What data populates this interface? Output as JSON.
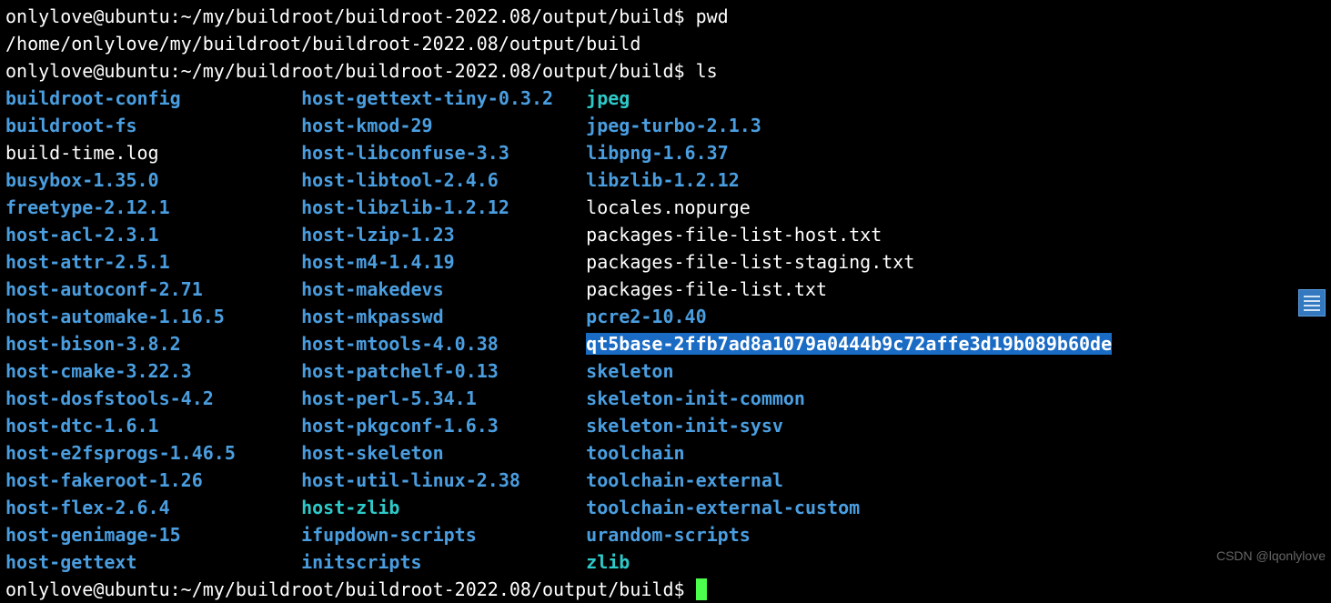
{
  "prompt1": "onlylove@ubuntu:~/my/buildroot/buildroot-2022.08/output/build$ ",
  "cmd1": "pwd",
  "pwd_out": "/home/onlylove/my/buildroot/buildroot-2022.08/output/build",
  "cmd2": "ls",
  "rows": [
    {
      "c1": {
        "t": "buildroot-config",
        "k": "dir"
      },
      "c2": {
        "t": "host-gettext-tiny-0.3.2",
        "k": "dir"
      },
      "c3": {
        "t": "jpeg",
        "k": "ln"
      }
    },
    {
      "c1": {
        "t": "buildroot-fs",
        "k": "dir"
      },
      "c2": {
        "t": "host-kmod-29",
        "k": "dir"
      },
      "c3": {
        "t": "jpeg-turbo-2.1.3",
        "k": "dir"
      }
    },
    {
      "c1": {
        "t": "build-time.log",
        "k": "file"
      },
      "c2": {
        "t": "host-libconfuse-3.3",
        "k": "dir"
      },
      "c3": {
        "t": "libpng-1.6.37",
        "k": "dir"
      }
    },
    {
      "c1": {
        "t": "busybox-1.35.0",
        "k": "dir"
      },
      "c2": {
        "t": "host-libtool-2.4.6",
        "k": "dir"
      },
      "c3": {
        "t": "libzlib-1.2.12",
        "k": "dir"
      }
    },
    {
      "c1": {
        "t": "freetype-2.12.1",
        "k": "dir"
      },
      "c2": {
        "t": "host-libzlib-1.2.12",
        "k": "dir"
      },
      "c3": {
        "t": "locales.nopurge",
        "k": "file"
      }
    },
    {
      "c1": {
        "t": "host-acl-2.3.1",
        "k": "dir"
      },
      "c2": {
        "t": "host-lzip-1.23",
        "k": "dir"
      },
      "c3": {
        "t": "packages-file-list-host.txt",
        "k": "file"
      }
    },
    {
      "c1": {
        "t": "host-attr-2.5.1",
        "k": "dir"
      },
      "c2": {
        "t": "host-m4-1.4.19",
        "k": "dir"
      },
      "c3": {
        "t": "packages-file-list-staging.txt",
        "k": "file"
      }
    },
    {
      "c1": {
        "t": "host-autoconf-2.71",
        "k": "dir"
      },
      "c2": {
        "t": "host-makedevs",
        "k": "dir"
      },
      "c3": {
        "t": "packages-file-list.txt",
        "k": "file"
      }
    },
    {
      "c1": {
        "t": "host-automake-1.16.5",
        "k": "dir"
      },
      "c2": {
        "t": "host-mkpasswd",
        "k": "dir"
      },
      "c3": {
        "t": "pcre2-10.40",
        "k": "dir"
      }
    },
    {
      "c1": {
        "t": "host-bison-3.8.2",
        "k": "dir"
      },
      "c2": {
        "t": "host-mtools-4.0.38",
        "k": "dir"
      },
      "c3": {
        "t": "qt5base-2ffb7ad8a1079a0444b9c72affe3d19b089b60de",
        "k": "sel"
      }
    },
    {
      "c1": {
        "t": "host-cmake-3.22.3",
        "k": "dir"
      },
      "c2": {
        "t": "host-patchelf-0.13",
        "k": "dir"
      },
      "c3": {
        "t": "skeleton",
        "k": "dir"
      }
    },
    {
      "c1": {
        "t": "host-dosfstools-4.2",
        "k": "dir"
      },
      "c2": {
        "t": "host-perl-5.34.1",
        "k": "dir"
      },
      "c3": {
        "t": "skeleton-init-common",
        "k": "dir"
      }
    },
    {
      "c1": {
        "t": "host-dtc-1.6.1",
        "k": "dir"
      },
      "c2": {
        "t": "host-pkgconf-1.6.3",
        "k": "dir"
      },
      "c3": {
        "t": "skeleton-init-sysv",
        "k": "dir"
      }
    },
    {
      "c1": {
        "t": "host-e2fsprogs-1.46.5",
        "k": "dir"
      },
      "c2": {
        "t": "host-skeleton",
        "k": "dir"
      },
      "c3": {
        "t": "toolchain",
        "k": "dir"
      }
    },
    {
      "c1": {
        "t": "host-fakeroot-1.26",
        "k": "dir"
      },
      "c2": {
        "t": "host-util-linux-2.38",
        "k": "dir"
      },
      "c3": {
        "t": "toolchain-external",
        "k": "dir"
      }
    },
    {
      "c1": {
        "t": "host-flex-2.6.4",
        "k": "dir"
      },
      "c2": {
        "t": "host-zlib",
        "k": "ln"
      },
      "c3": {
        "t": "toolchain-external-custom",
        "k": "dir"
      }
    },
    {
      "c1": {
        "t": "host-genimage-15",
        "k": "dir"
      },
      "c2": {
        "t": "ifupdown-scripts",
        "k": "dir"
      },
      "c3": {
        "t": "urandom-scripts",
        "k": "dir"
      }
    },
    {
      "c1": {
        "t": "host-gettext",
        "k": "dir"
      },
      "c2": {
        "t": "initscripts",
        "k": "dir"
      },
      "c3": {
        "t": "zlib",
        "k": "ln"
      }
    }
  ],
  "watermark": "CSDN @lqonlylove"
}
